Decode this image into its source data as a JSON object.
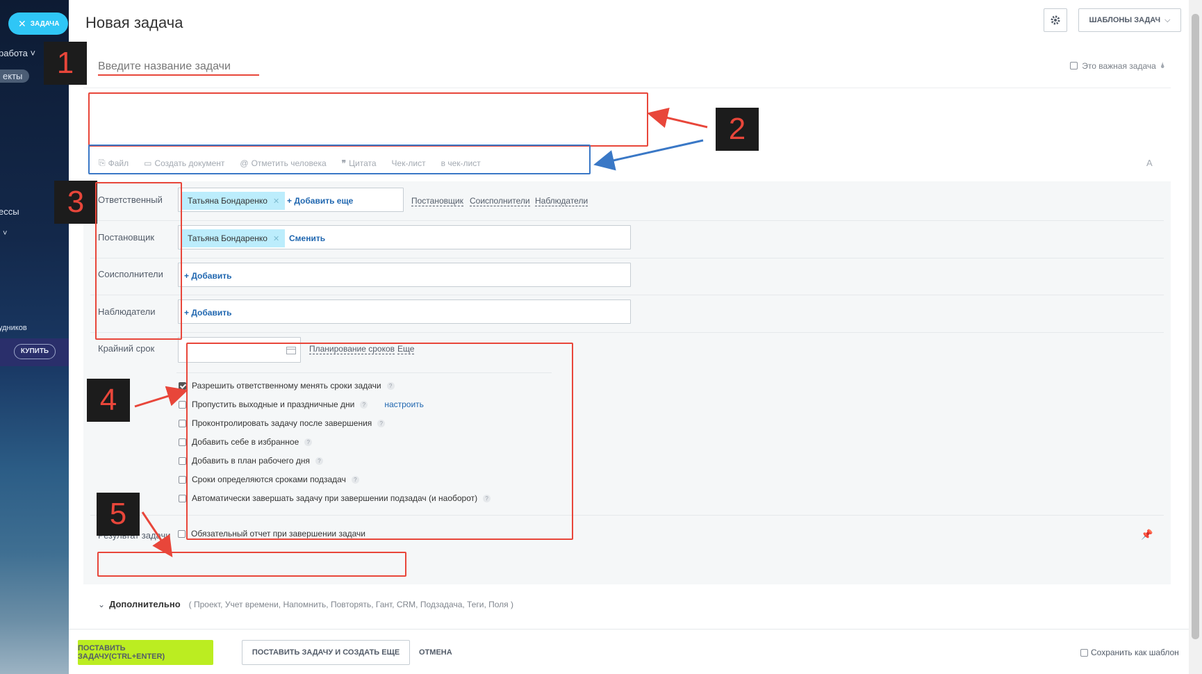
{
  "sidebar": {
    "task_pill": "ЗАДАЧА",
    "work_label": "работа",
    "projects_label": "екты",
    "processes_label": "ессы",
    "employees_label": "удников",
    "buy_label": "КУПИТЬ"
  },
  "header": {
    "title": "Новая задача",
    "templates_label": "ШАБЛОНЫ ЗАДАЧ"
  },
  "task": {
    "title_placeholder": "Введите название задачи",
    "important_label": "Это важная задача"
  },
  "toolbar": {
    "items": [
      "Файл",
      "Создать документ",
      "Отметить человека",
      "Цитата",
      "Чек-лист",
      "в чек-лист"
    ],
    "font_label": "A"
  },
  "people": {
    "responsible_label": "Ответственный",
    "responsible_person": "Татьяна Бондаренко",
    "add_more_label": "+ Добавить еще",
    "links": [
      "Постановщик",
      "Соисполнители",
      "Наблюдатели"
    ],
    "creator_label": "Постановщик",
    "creator_person": "Татьяна Бондаренко",
    "change_label": "Сменить",
    "coexecutors_label": "Соисполнители",
    "observers_label": "Наблюдатели",
    "add_label": "+ Добавить"
  },
  "deadline": {
    "label": "Крайний срок",
    "planning_link": "Планирование сроков",
    "more_link": "Еще",
    "options": [
      {
        "label": "Разрешить ответственному менять сроки задачи",
        "checked": true
      },
      {
        "label": "Пропустить выходные и праздничные дни",
        "checked": false,
        "link": "настроить"
      },
      {
        "label": "Проконтролировать задачу после завершения",
        "checked": false
      },
      {
        "label": "Добавить себе в избранное",
        "checked": false
      },
      {
        "label": "Добавить в план рабочего дня",
        "checked": false
      },
      {
        "label": "Сроки определяются сроками подзадач",
        "checked": false
      },
      {
        "label": "Автоматически завершать задачу при завершении подзадач (и наоборот)",
        "checked": false
      }
    ]
  },
  "result": {
    "label": "Результат задачи",
    "option": "Обязательный отчет при завершении задачи"
  },
  "extra": {
    "label": "Дополнительно",
    "items": "( Проект,  Учет времени,  Напомнить,  Повторять,  Гант,  CRM,  Подзадача,  Теги,  Поля )"
  },
  "footer": {
    "submit": "ПОСТАВИТЬ ЗАДАЧУ(CTRL+ENTER)",
    "submit_and_new": "ПОСТАВИТЬ ЗАДАЧУ И СОЗДАТЬ ЕЩЕ",
    "cancel": "ОТМЕНА",
    "save_template": "Сохранить как шаблон"
  },
  "annotations": [
    "1",
    "2",
    "3",
    "4",
    "5"
  ],
  "colors": {
    "accent_green": "#bbed21",
    "link_blue": "#2067b0",
    "annotation_red": "#e8463a",
    "annotation_blue": "#3a78c6",
    "chip_blue": "#bcedfc"
  }
}
